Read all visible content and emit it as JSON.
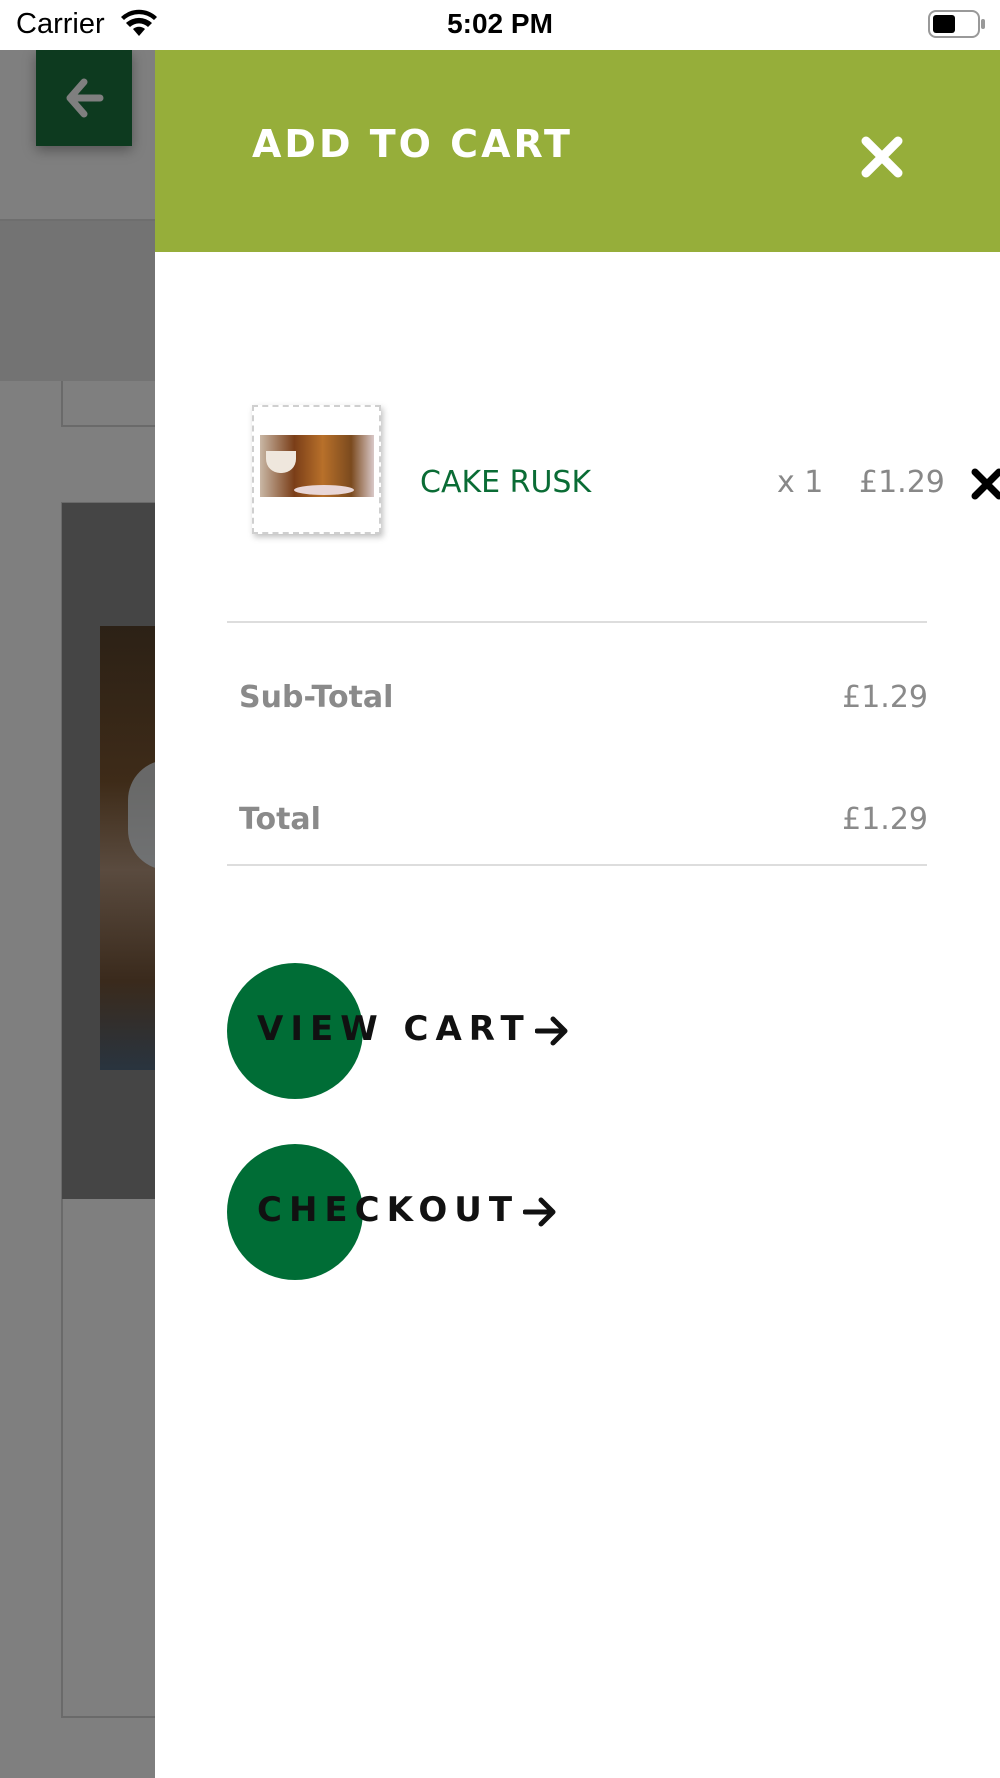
{
  "status_bar": {
    "carrier": "Carrier",
    "time": "5:02 PM"
  },
  "drawer": {
    "title": "ADD TO CART",
    "header_color": "#96ae3a",
    "item": {
      "name": "CAKE RUSK",
      "quantity": "x 1",
      "price": "£1.29"
    },
    "summary": {
      "subtotal_label": "Sub-Total",
      "subtotal_value": "£1.29",
      "total_label": "Total",
      "total_value": "£1.29"
    },
    "actions": {
      "view_cart_label": "VIEW CART",
      "checkout_label": "CHECKOUT",
      "accent_color": "#006d36"
    }
  },
  "icons": {
    "back": "arrow-left-icon",
    "close": "close-icon",
    "remove": "remove-item-icon",
    "arrow": "arrow-right-icon"
  }
}
